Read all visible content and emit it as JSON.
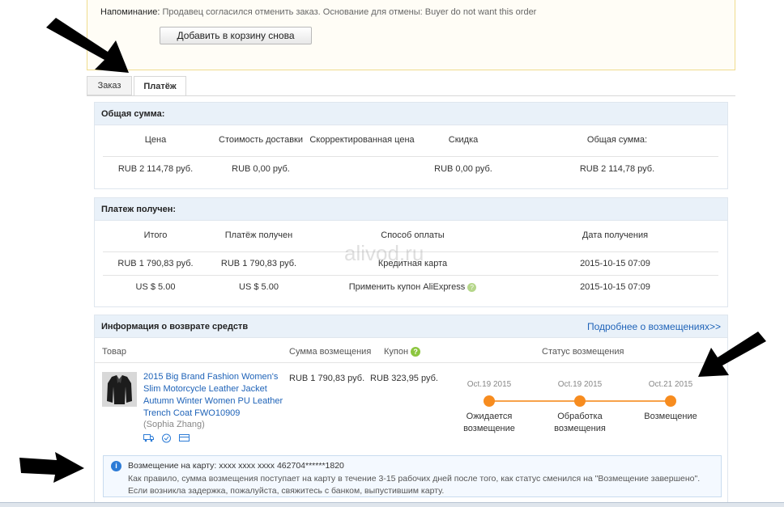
{
  "notice": {
    "label": "Напоминание:",
    "text": "Продавец согласился отменить заказ. Основание для отмены: Buyer do not want this order",
    "readd_button": "Добавить в корзину снова"
  },
  "tabs": {
    "order": "Заказ",
    "payment": "Платёж"
  },
  "total": {
    "title": "Общая сумма:",
    "columns": [
      "Цена",
      "Стоимость доставки",
      "Скорректированная цена",
      "Скидка",
      "Общая сумма:"
    ],
    "row": [
      "RUB 2 114,78 руб.",
      "RUB 0,00 руб.",
      "",
      "RUB 0,00 руб.",
      "RUB 2 114,78 руб."
    ]
  },
  "payment": {
    "title": "Платеж получен:",
    "columns": [
      "Итого",
      "Платёж получен",
      "Способ оплаты",
      "Дата получения"
    ],
    "rows": [
      [
        "RUB 1 790,83 руб.",
        "RUB 1 790,83 руб.",
        "Кредитная карта",
        "2015-10-15 07:09"
      ],
      [
        "US $ 5.00",
        "US $ 5.00",
        "Применить купон AliExpress",
        "2015-10-15 07:09"
      ]
    ]
  },
  "refund": {
    "title": "Информация о возврате средств",
    "more_link": "Подробнее о возмещениях>>",
    "columns": {
      "product": "Товар",
      "amount": "Сумма возмещения",
      "coupon": "Купон",
      "status": "Статус возмещения"
    },
    "product_title": "2015 Big Brand Fashion Women's Slim Motorcycle Leather Jacket Autumn Winter Women PU Leather Trench Coat FWO10909",
    "seller": "(Sophia Zhang)",
    "amount": "RUB 1 790,83 руб.",
    "coupon": "RUB 323,95 руб.",
    "steps": [
      {
        "date": "Oct.19 2015",
        "label_1": "Ожидается",
        "label_2": "возмещение"
      },
      {
        "date": "Oct.19 2015",
        "label_1": "Обработка",
        "label_2": "возмещения"
      },
      {
        "date": "Oct.21 2015",
        "label_1": "Возмещение",
        "label_2": ""
      }
    ],
    "info_line1": "Возмещение на карту: xxxx xxxx xxxx 462704******1820",
    "info_line2": "Как правило, сумма возмещения поступает на карту в течение 3-15 рабочих дней после того, как статус сменился на \"Возмещение завершено\". Если возникла задержка, пожалуйста, свяжитесь с банком, выпустившим карту."
  },
  "watermark": "alivod.ru",
  "colors": {
    "accent": "#f78c1f",
    "link": "#1f63b8",
    "panel_header": "#e9f1f9"
  }
}
